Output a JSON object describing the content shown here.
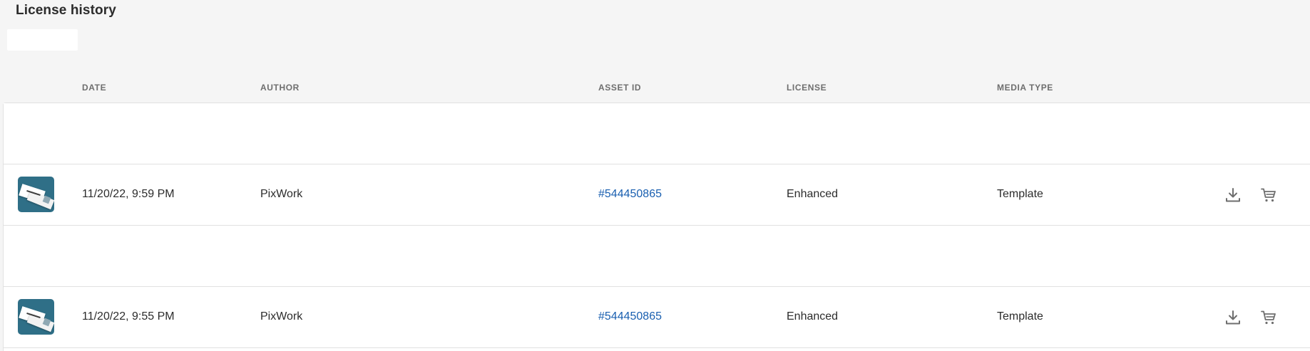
{
  "page": {
    "title": "License history"
  },
  "table": {
    "columns": [
      "DATE",
      "AUTHOR",
      "ASSET ID",
      "LICENSE",
      "MEDIA TYPE"
    ],
    "rows": [
      {
        "date": "11/20/22, 9:59 PM",
        "author": "PixWork",
        "asset_id": "#544450865",
        "license": "Enhanced",
        "media_type": "Template",
        "actions": [
          "download-icon",
          "cart-icon"
        ]
      },
      {
        "date": "11/20/22, 9:55 PM",
        "author": "PixWork",
        "asset_id": "#544450865",
        "license": "Enhanced",
        "media_type": "Template",
        "actions": [
          "download-icon",
          "cart-icon"
        ]
      }
    ]
  },
  "colors": {
    "background": "#f5f5f5",
    "link": "#195fb0",
    "thumbnail": "#2f6f87"
  }
}
